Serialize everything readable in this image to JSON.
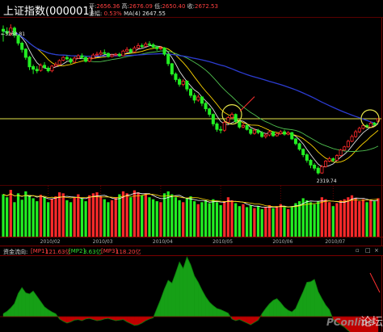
{
  "header": {
    "title": "上证指数(000001)",
    "open_label": "开",
    "open": "2656.36",
    "high_label": "高",
    "high": "2676.09",
    "low_label": "低",
    "low": "2650.40",
    "close_label": "收",
    "close": "2672.53",
    "chg_label": "涨幅",
    "chg": "0.53%",
    "ma_label": "MA(4)",
    "ma_value": "2647.55"
  },
  "price_chart": {
    "high_marker": "3268.81",
    "low_marker": "2319.74"
  },
  "fund_panel": {
    "title": "资金流向:",
    "mp1_label": "[MP1]",
    "mp1_value": "121.63亿",
    "mp2_label": "[MP2]",
    "mp2_value": "3.63亿",
    "mp3_label": "[MP3]",
    "mp3_value": "118.20亿"
  },
  "date_axis": [
    "2010/02",
    "2010/03",
    "2010/04",
    "2010/05",
    "2010/06",
    "2010/07"
  ],
  "watermark": {
    "brand": "PConline",
    "forum": "论坛"
  },
  "colors": {
    "up": "#ff2a2a",
    "down": "#22ee22",
    "ma_white": "#e0e0e0",
    "ma_yellow": "#ffd700",
    "ma_green": "#4fc04f",
    "ma_blue": "#2c3cd0",
    "level": "#e3e34a",
    "fund_green": "#16a016",
    "fund_red": "#c00000"
  },
  "chart_data": {
    "type": "candlestick",
    "title": "上证指数(000001)",
    "ylim": [
      2300,
      3300
    ],
    "candles": [
      [
        3238,
        3225,
        3262,
        3160
      ],
      [
        3225,
        3212,
        3250,
        3200
      ],
      [
        3210,
        3245,
        3268.81,
        3196
      ],
      [
        3245,
        3200,
        3255,
        3185
      ],
      [
        3198,
        3150,
        3205,
        3135
      ],
      [
        3150,
        3110,
        3160,
        3090
      ],
      [
        3112,
        3060,
        3118,
        3045
      ],
      [
        3062,
        3000,
        3070,
        2980
      ],
      [
        3002,
        2985,
        3015,
        2955
      ],
      [
        2985,
        2975,
        3005,
        2960
      ],
      [
        2978,
        3010,
        3022,
        2970
      ],
      [
        3010,
        2995,
        3030,
        2990
      ],
      [
        2992,
        2975,
        3003,
        2965
      ],
      [
        2975,
        3005,
        3012,
        2966
      ],
      [
        3005,
        3015,
        3030,
        3001
      ],
      [
        3015,
        3040,
        3048,
        3010
      ],
      [
        3042,
        3060,
        3068,
        3035
      ],
      [
        3060,
        3050,
        3074,
        3041
      ],
      [
        3050,
        3030,
        3058,
        3020
      ],
      [
        3030,
        3055,
        3066,
        3026
      ],
      [
        3055,
        3070,
        3080,
        3050
      ],
      [
        3070,
        3060,
        3085,
        3052
      ],
      [
        3060,
        3035,
        3068,
        3028
      ],
      [
        3035,
        3055,
        3062,
        3030
      ],
      [
        3055,
        3075,
        3086,
        3050
      ],
      [
        3075,
        3080,
        3095,
        3070
      ],
      [
        3080,
        3090,
        3105,
        3072
      ],
      [
        3090,
        3085,
        3110,
        3080
      ],
      [
        3085,
        3065,
        3092,
        3058
      ],
      [
        3065,
        3075,
        3082,
        3060
      ],
      [
        3075,
        3080,
        3088,
        3068
      ],
      [
        3080,
        3070,
        3090,
        3062
      ],
      [
        3070,
        3100,
        3108,
        3068
      ],
      [
        3100,
        3110,
        3125,
        3095
      ],
      [
        3110,
        3095,
        3118,
        3085
      ],
      [
        3095,
        3120,
        3132,
        3090
      ],
      [
        3120,
        3135,
        3150,
        3115
      ],
      [
        3135,
        3128,
        3148,
        3120
      ],
      [
        3130,
        3145,
        3158,
        3125
      ],
      [
        3145,
        3140,
        3162,
        3130
      ],
      [
        3140,
        3125,
        3150,
        3118
      ],
      [
        3125,
        3115,
        3135,
        3102
      ],
      [
        3115,
        3120,
        3132,
        3108
      ],
      [
        3120,
        3080,
        3125,
        3070
      ],
      [
        3080,
        3020,
        3085,
        3005
      ],
      [
        3020,
        2955,
        3025,
        2945
      ],
      [
        2955,
        2920,
        2965,
        2905
      ],
      [
        2920,
        2890,
        2932,
        2875
      ],
      [
        2890,
        2910,
        2922,
        2878
      ],
      [
        2910,
        2860,
        2915,
        2845
      ],
      [
        2860,
        2820,
        2868,
        2805
      ],
      [
        2820,
        2790,
        2835,
        2770
      ],
      [
        2790,
        2810,
        2825,
        2780
      ],
      [
        2810,
        2770,
        2815,
        2752
      ],
      [
        2770,
        2735,
        2778,
        2718
      ],
      [
        2735,
        2700,
        2742,
        2685
      ],
      [
        2700,
        2640,
        2706,
        2625
      ],
      [
        2640,
        2605,
        2650,
        2590
      ],
      [
        2605,
        2600,
        2625,
        2580
      ],
      [
        2600,
        2650,
        2662,
        2590
      ],
      [
        2650,
        2680,
        2690,
        2640
      ],
      [
        2680,
        2700,
        2712,
        2672
      ],
      [
        2700,
        2655,
        2706,
        2645
      ],
      [
        2655,
        2620,
        2665,
        2610
      ],
      [
        2620,
        2630,
        2645,
        2612
      ],
      [
        2630,
        2605,
        2640,
        2598
      ],
      [
        2605,
        2580,
        2612,
        2570
      ],
      [
        2580,
        2600,
        2612,
        2572
      ],
      [
        2600,
        2585,
        2608,
        2575
      ],
      [
        2585,
        2560,
        2595,
        2552
      ],
      [
        2560,
        2570,
        2580,
        2548
      ],
      [
        2570,
        2590,
        2598,
        2562
      ],
      [
        2590,
        2565,
        2595,
        2558
      ],
      [
        2565,
        2578,
        2586,
        2560
      ],
      [
        2578,
        2590,
        2600,
        2572
      ],
      [
        2590,
        2575,
        2602,
        2566
      ],
      [
        2575,
        2585,
        2594,
        2568
      ],
      [
        2585,
        2545,
        2590,
        2538
      ],
      [
        2545,
        2515,
        2552,
        2505
      ],
      [
        2515,
        2480,
        2522,
        2470
      ],
      [
        2480,
        2445,
        2486,
        2430
      ],
      [
        2445,
        2410,
        2455,
        2395
      ],
      [
        2410,
        2380,
        2418,
        2360
      ],
      [
        2380,
        2360,
        2392,
        2345
      ],
      [
        2360,
        2330,
        2372,
        2319.74
      ],
      [
        2330,
        2370,
        2380,
        2325
      ],
      [
        2370,
        2405,
        2412,
        2365
      ],
      [
        2405,
        2420,
        2432,
        2398
      ],
      [
        2420,
        2410,
        2428,
        2400
      ],
      [
        2410,
        2440,
        2448,
        2406
      ],
      [
        2440,
        2475,
        2482,
        2436
      ],
      [
        2475,
        2495,
        2502,
        2470
      ],
      [
        2495,
        2530,
        2540,
        2490
      ],
      [
        2530,
        2560,
        2572,
        2524
      ],
      [
        2560,
        2590,
        2602,
        2552
      ],
      [
        2590,
        2612,
        2622,
        2582
      ],
      [
        2612,
        2630,
        2642,
        2605
      ],
      [
        2630,
        2620,
        2640,
        2610
      ],
      [
        2620,
        2645,
        2655,
        2615
      ],
      [
        2645,
        2635,
        2652,
        2628
      ],
      [
        2656.36,
        2672.53,
        2676.09,
        2650.4
      ]
    ],
    "volume": [
      86,
      80,
      95,
      70,
      88,
      75,
      92,
      84,
      78,
      72,
      85,
      80,
      70,
      76,
      82,
      90,
      88,
      74,
      70,
      80,
      86,
      78,
      72,
      84,
      88,
      90,
      82,
      76,
      70,
      74,
      80,
      86,
      92,
      88,
      80,
      94,
      90,
      84,
      88,
      80,
      76,
      72,
      70,
      88,
      92,
      86,
      80,
      74,
      70,
      78,
      82,
      72,
      66,
      70,
      74,
      68,
      76,
      70,
      64,
      72,
      80,
      74,
      68,
      62,
      66,
      60,
      64,
      58,
      62,
      56,
      60,
      64,
      58,
      62,
      66,
      60,
      56,
      62,
      68,
      72,
      78,
      74,
      70,
      66,
      72,
      80,
      76,
      70,
      62,
      68,
      74,
      76,
      80,
      84,
      78,
      72,
      76,
      70,
      74,
      72,
      78
    ],
    "fund_flow": [
      10,
      18,
      30,
      45,
      80,
      100,
      82,
      78,
      88,
      70,
      52,
      34,
      24,
      16,
      10,
      -8,
      -16,
      -22,
      -18,
      -12,
      -10,
      -14,
      -8,
      -6,
      -10,
      -14,
      -12,
      -8,
      -6,
      -10,
      -14,
      -12,
      -10,
      -18,
      -24,
      -30,
      -28,
      -22,
      -14,
      -8,
      -4,
      28,
      60,
      95,
      125,
      115,
      150,
      188,
      165,
      205,
      178,
      140,
      118,
      92,
      68,
      50,
      38,
      28,
      24,
      18,
      12,
      -8,
      -14,
      -10,
      -16,
      -22,
      -28,
      -20,
      -12,
      10,
      28,
      44,
      56,
      62,
      48,
      32,
      22,
      16,
      28,
      58,
      86,
      118,
      120,
      128,
      86,
      62,
      40,
      24,
      -10,
      -20,
      -28,
      -36,
      -48,
      -58,
      -64,
      -70,
      -62,
      -72,
      -78,
      -70,
      -66
    ]
  }
}
